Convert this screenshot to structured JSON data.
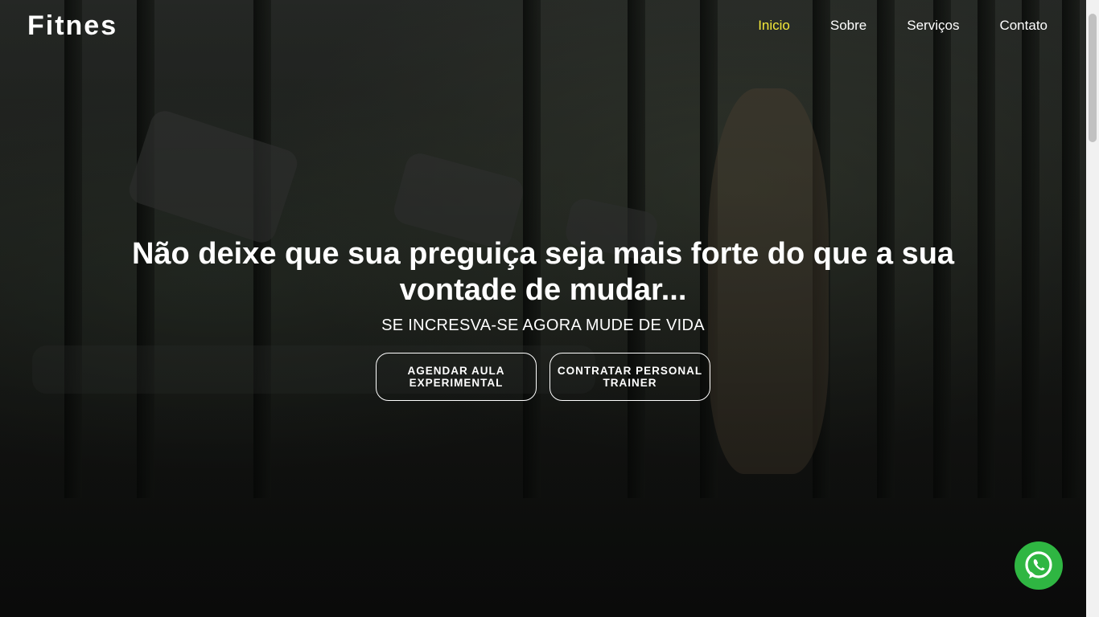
{
  "navbar": {
    "logo": "Fitnes",
    "links": [
      {
        "label": "Inicio",
        "active": true
      },
      {
        "label": "Sobre",
        "active": false
      },
      {
        "label": "Serviços",
        "active": false
      },
      {
        "label": "Contato",
        "active": false
      }
    ]
  },
  "hero": {
    "headline": "Não deixe que sua preguiça seja mais forte do que a sua vontade de mudar...",
    "subtitle": "SE INCRESVA-SE AGORA MUDE DE VIDA",
    "buttons": [
      {
        "label": "AGENDAR AULA EXPERIMENTAL"
      },
      {
        "label": "CONTRATAR PERSONAL TRAINER"
      }
    ]
  },
  "floating": {
    "whatsapp_icon": "whatsapp-icon"
  },
  "colors": {
    "active_nav": "#f5e93a",
    "whatsapp": "#2fb642"
  }
}
